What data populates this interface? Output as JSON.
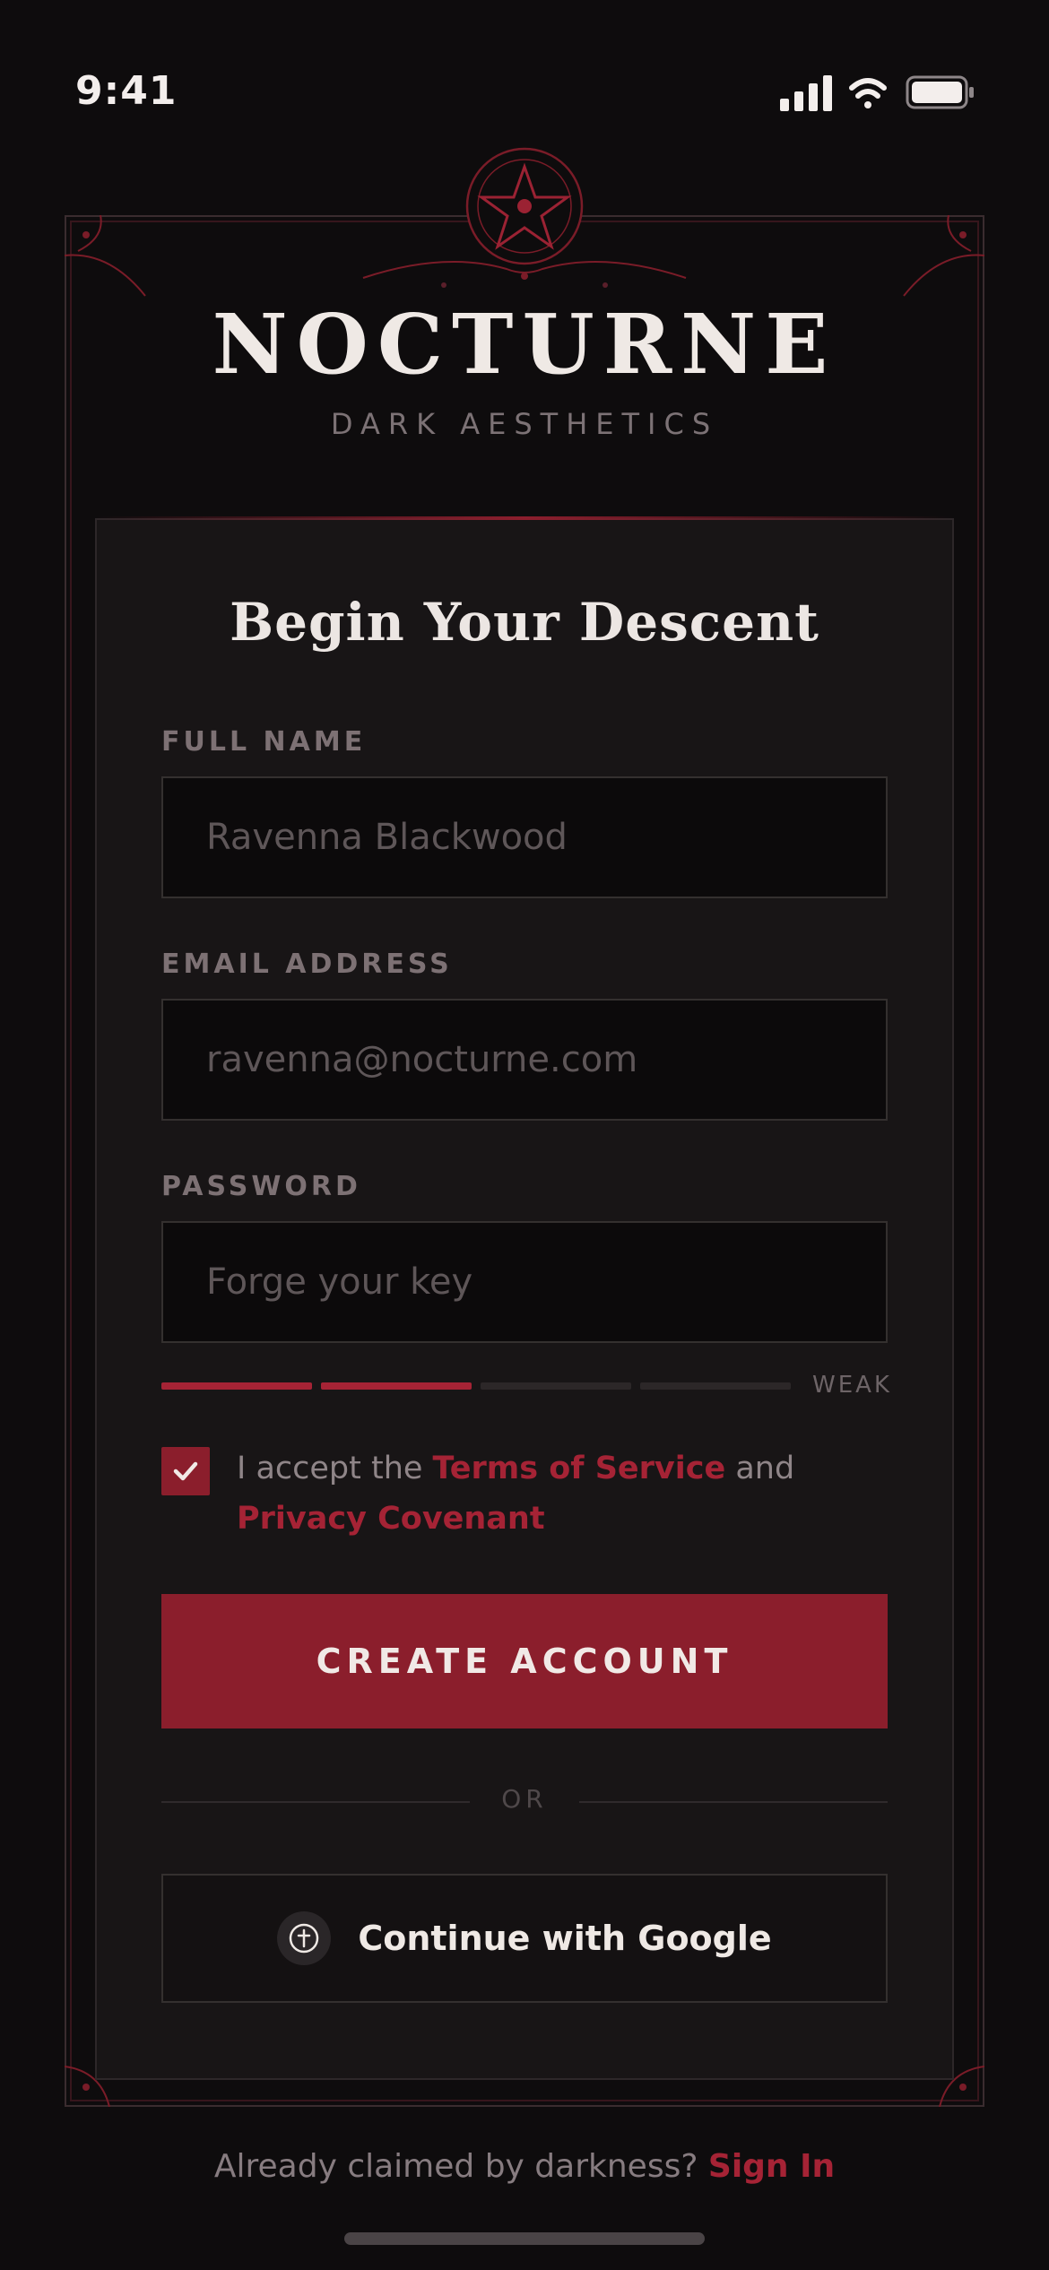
{
  "status_bar": {
    "time": "9:41"
  },
  "brand": {
    "title": "NOCTURNE",
    "subtitle": "DARK AESTHETICS"
  },
  "form": {
    "title": "Begin Your Descent",
    "full_name": {
      "label": "FULL NAME",
      "placeholder": "Ravenna Blackwood"
    },
    "email": {
      "label": "EMAIL ADDRESS",
      "placeholder": "ravenna@nocturne.com"
    },
    "password": {
      "label": "PASSWORD",
      "placeholder": "Forge your key"
    },
    "strength": {
      "label": "WEAK",
      "filled_segments": 2,
      "total_segments": 4
    },
    "terms": {
      "checked": true,
      "prefix": "I accept the ",
      "terms_link": "Terms of Service",
      "middle": " and ",
      "privacy_link": "Privacy Covenant"
    },
    "submit_label": "CREATE ACCOUNT",
    "divider_label": "OR",
    "google_label": "Continue with Google"
  },
  "footer": {
    "prompt": "Already claimed by darkness? ",
    "signin_label": "Sign In"
  },
  "colors": {
    "accent": "#8b1e2c",
    "link": "#a52335",
    "background": "#0e0c0d",
    "card": "#181516"
  },
  "icons": [
    "cellular-signal-icon",
    "wifi-icon",
    "battery-icon",
    "pentagram-emblem-icon",
    "checkmark-icon",
    "cross-emblem-icon"
  ]
}
